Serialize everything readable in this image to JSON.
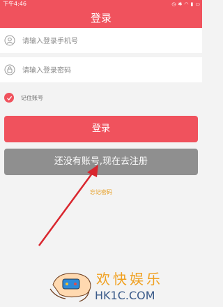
{
  "status_bar": {
    "time": "下午4:46",
    "icons": [
      "alarm-icon",
      "bluetooth-icon",
      "wifi-icon",
      "signal-icon",
      "battery-icon"
    ]
  },
  "header": {
    "title": "登录"
  },
  "form": {
    "phone_placeholder": "请输入登录手机号",
    "password_placeholder": "请输入登录密码",
    "remember_label": "记住账号",
    "remember_checked": true,
    "login_button": "登录",
    "register_button": "还没有账号,现在去注册",
    "forgot_link": "忘记密码"
  },
  "watermark": {
    "brand": "欢快娱乐",
    "site": "HK1C.COM"
  },
  "colors": {
    "accent": "#f0525d",
    "register_button": "#8f8f8f",
    "forgot_link": "#e69b1c",
    "annotation_arrow": "#d9262e"
  }
}
